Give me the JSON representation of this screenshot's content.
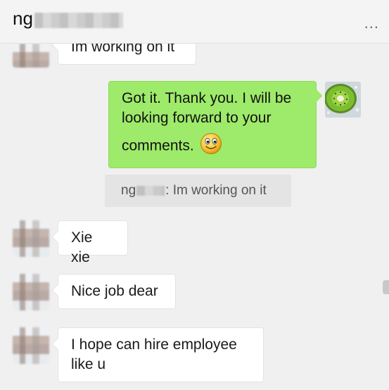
{
  "header": {
    "contact_name_prefix": "ng",
    "more_label": "..."
  },
  "messages": [
    {
      "id": "m0",
      "side": "left",
      "text": "Im working on it"
    },
    {
      "id": "m1",
      "side": "right",
      "text_line1": "Got it. Thank you. I will be",
      "text_line2": "looking forward to your",
      "text_line3": "comments.",
      "emoji": "smiley-emoji"
    },
    {
      "id": "m2",
      "side": "left",
      "text": "Xie xie"
    },
    {
      "id": "m3",
      "side": "left",
      "text": "Nice job dear"
    },
    {
      "id": "m4",
      "side": "left",
      "text_line1": "I hope can hire employee",
      "text_line2": "like u"
    }
  ],
  "quote": {
    "sender_prefix": "ng",
    "text": ": Im working on it"
  },
  "colors": {
    "my_bubble": "#9eea6a",
    "their_bubble": "#ffffff",
    "background": "#f0f0f0"
  }
}
